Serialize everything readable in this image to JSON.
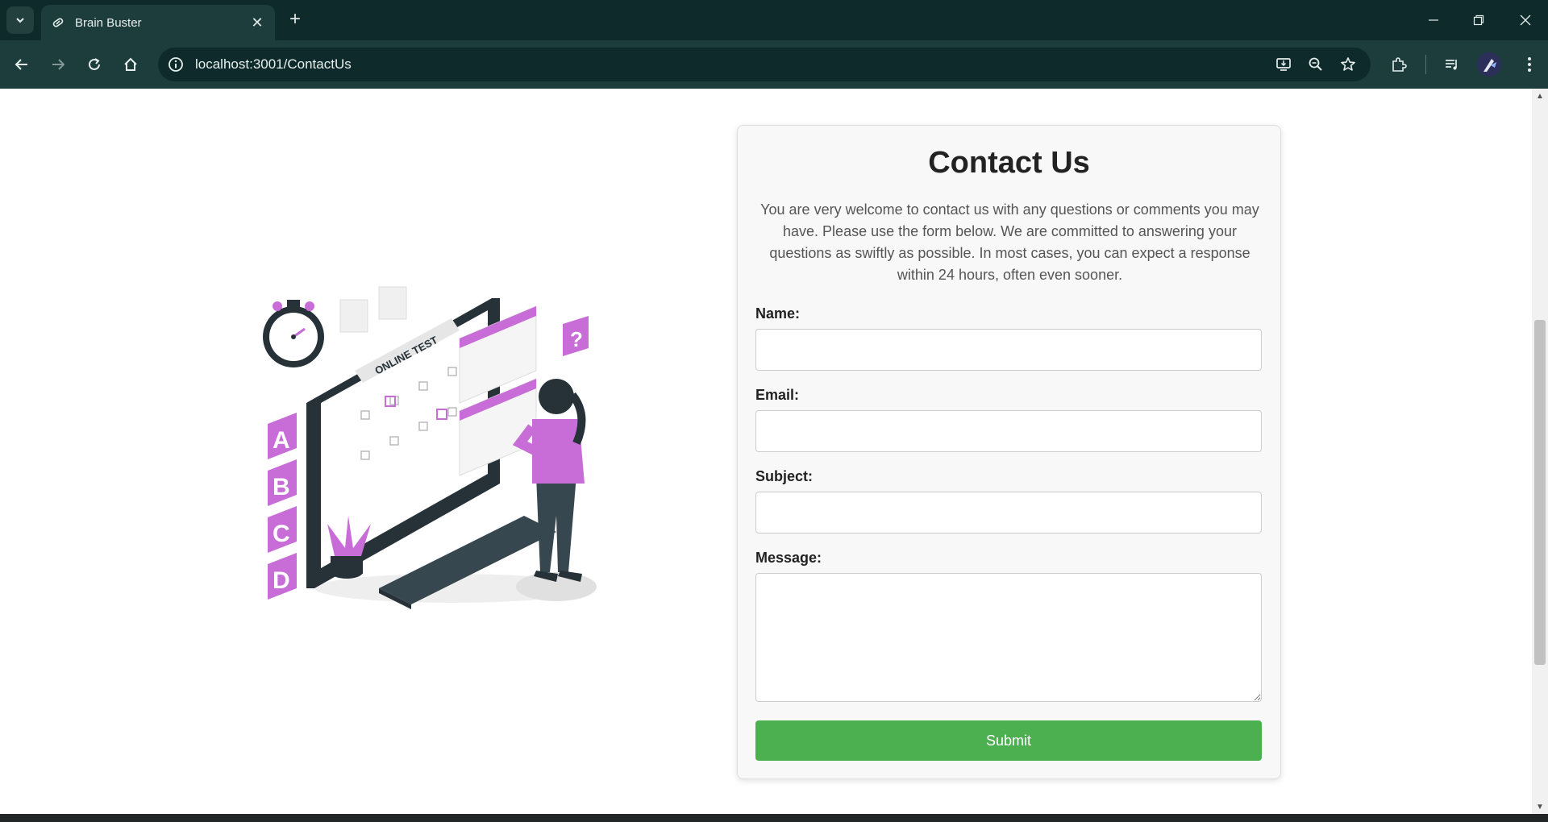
{
  "browser": {
    "tab_title": "Brain Buster",
    "url": "localhost:3001/ContactUs",
    "theme_color": "#1d3d3c"
  },
  "page": {
    "heading": "Contact Us",
    "intro": "You are very welcome to contact us with any questions or comments you may have. Please use the form below. We are committed to answering your questions as swiftly as possible. In most cases, you can expect a response within 24 hours, often even sooner.",
    "form": {
      "name_label": "Name:",
      "email_label": "Email:",
      "subject_label": "Subject:",
      "message_label": "Message:",
      "name_value": "",
      "email_value": "",
      "subject_value": "",
      "message_value": "",
      "submit_label": "Submit",
      "submit_color": "#4caf50"
    },
    "illustration": {
      "screen_text": "ONLINE TEST",
      "option_letters": [
        "A",
        "B",
        "C",
        "D"
      ],
      "accent_color": "#c86dd7",
      "dark_color": "#263238"
    }
  }
}
